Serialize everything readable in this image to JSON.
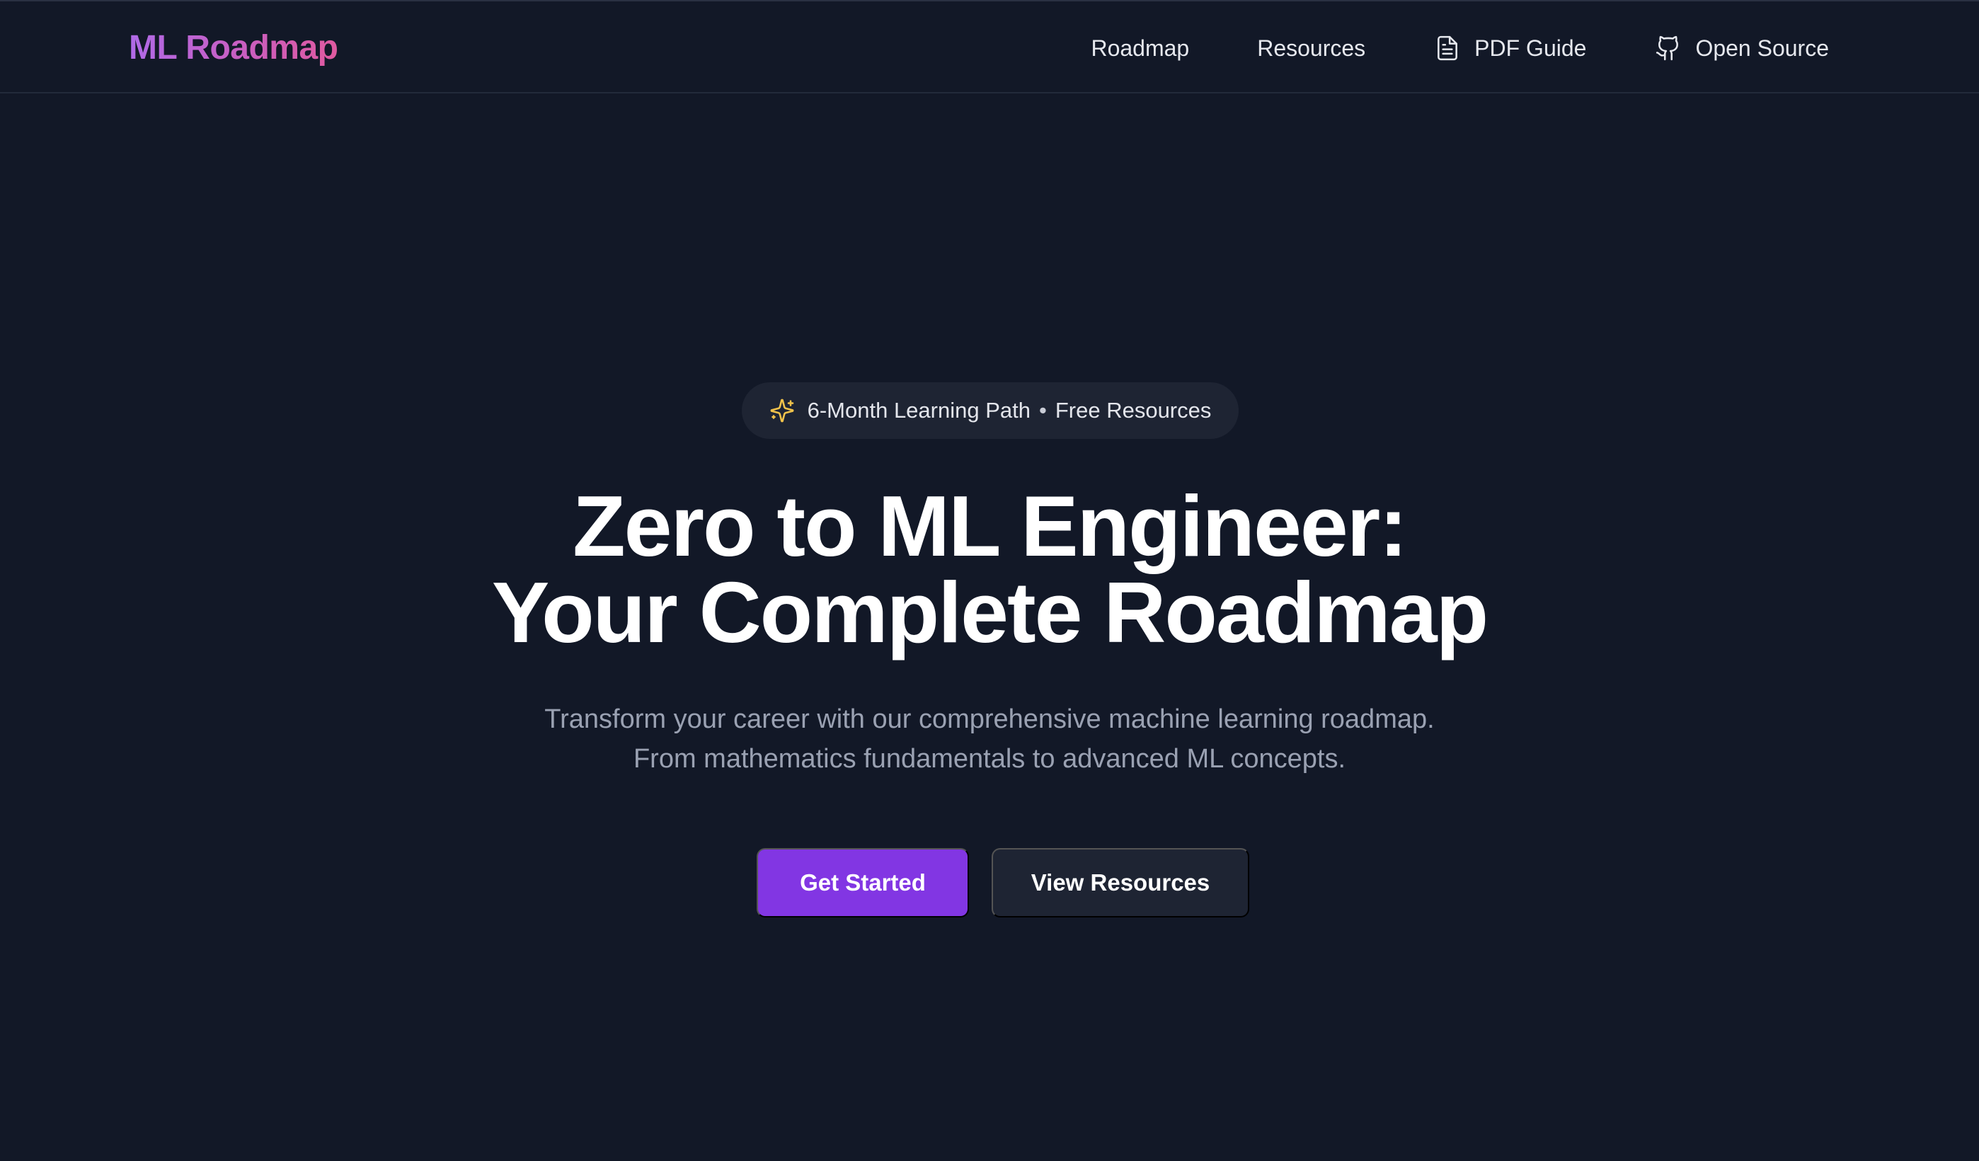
{
  "nav": {
    "logo": "ML Roadmap",
    "links": [
      {
        "label": "Roadmap",
        "icon": ""
      },
      {
        "label": "Resources",
        "icon": ""
      },
      {
        "label": "PDF Guide",
        "icon": "document-icon"
      },
      {
        "label": "Open Source",
        "icon": "github-icon"
      }
    ]
  },
  "hero": {
    "badge": {
      "icon": "sparkles-icon",
      "left_text": "6-Month Learning Path",
      "separator": "•",
      "right_text": "Free Resources"
    },
    "headline": [
      "Zero to ML Engineer:",
      "Your Complete Roadmap"
    ],
    "subtitle": [
      "Transform your career with our comprehensive machine learning roadmap.",
      "From mathematics fundamentals to advanced ML concepts."
    ],
    "cta": {
      "primary": "Get Started",
      "secondary": "View Resources"
    }
  },
  "colors": {
    "background": "#121827",
    "accent": "#8236e3",
    "secondary_button": "#1e2433",
    "logo_gradient_start": "#b06ae8",
    "logo_gradient_end": "#e05aa0",
    "sparkle": "#f2c34b",
    "muted_text": "#9aa1b2"
  }
}
